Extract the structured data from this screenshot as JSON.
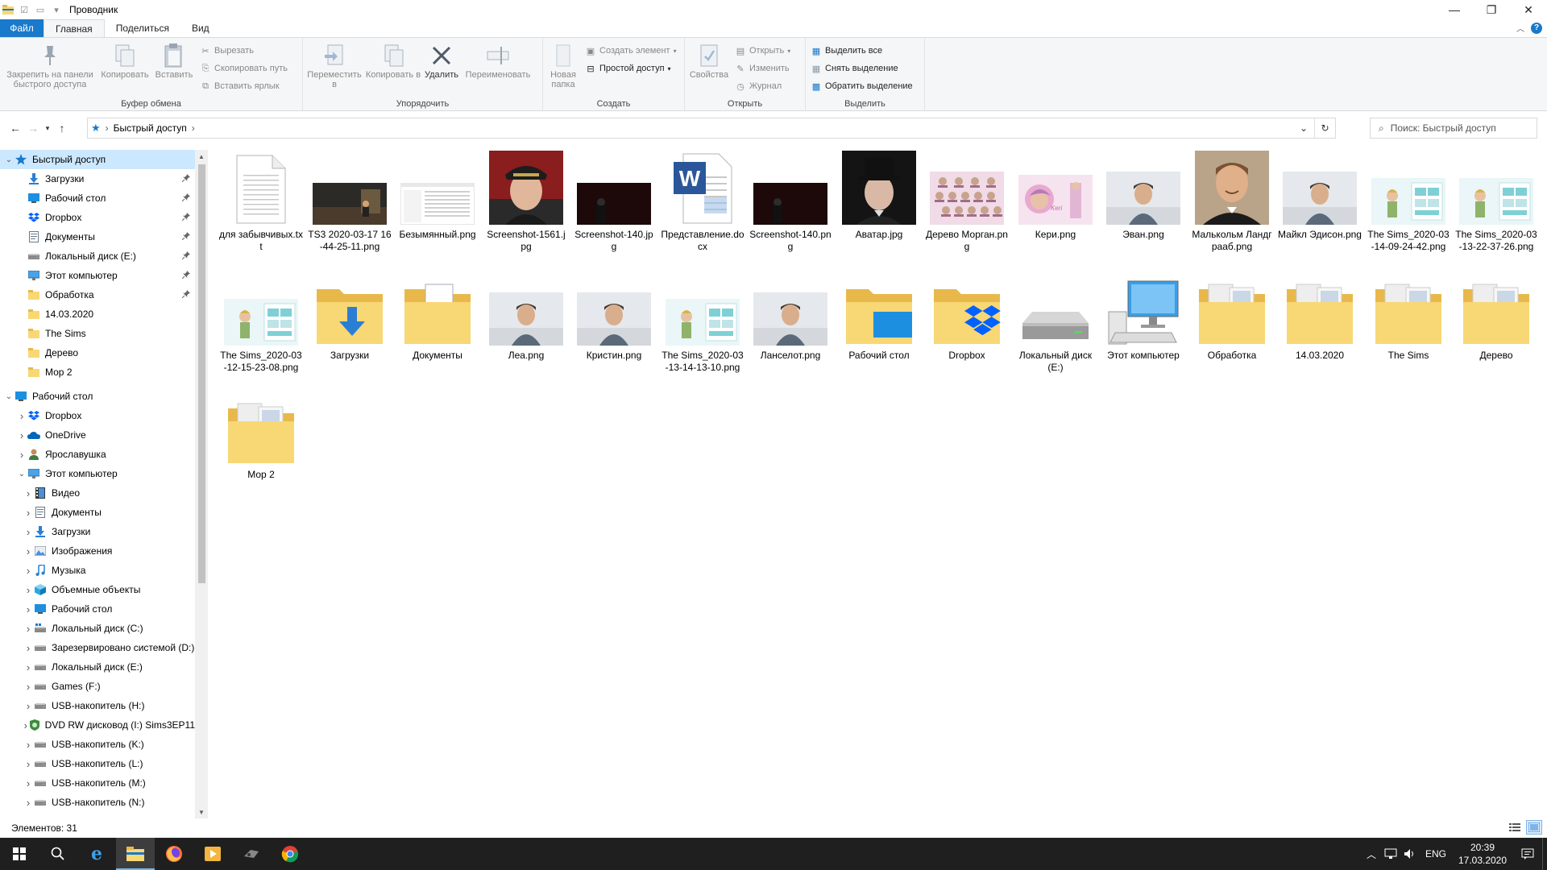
{
  "window": {
    "title": "Проводник",
    "controls": {
      "minimize": "—",
      "maximize": "❐",
      "close": "✕"
    }
  },
  "ribbon_tabs": [
    {
      "label": "Файл"
    },
    {
      "label": "Главная"
    },
    {
      "label": "Поделиться"
    },
    {
      "label": "Вид"
    }
  ],
  "ribbon": {
    "clipboard": {
      "group_label": "Буфер обмена",
      "pin": "Закрепить на панели быстрого доступа",
      "copy": "Копировать",
      "paste": "Вставить",
      "cut": "Вырезать",
      "copy_path": "Скопировать путь",
      "paste_shortcut": "Вставить ярлык"
    },
    "organize": {
      "group_label": "Упорядочить",
      "move_to": "Переместить в",
      "copy_to": "Копировать в",
      "delete": "Удалить",
      "rename": "Переименовать"
    },
    "new": {
      "group_label": "Создать",
      "new_folder": "Новая папка",
      "new_item": "Создать элемент",
      "easy_access": "Простой доступ"
    },
    "open": {
      "group_label": "Открыть",
      "properties": "Свойства",
      "open": "Открыть",
      "edit": "Изменить",
      "history": "Журнал"
    },
    "select": {
      "group_label": "Выделить",
      "select_all": "Выделить все",
      "select_none": "Снять выделение",
      "invert": "Обратить выделение"
    }
  },
  "address": {
    "separator": "›",
    "path": "Быстрый доступ",
    "search_placeholder": "Поиск: Быстрый доступ"
  },
  "sidebar": {
    "items": [
      {
        "label": "Быстрый доступ",
        "icon": "star-icon",
        "level": 0,
        "arrow": "expanded",
        "pinned": false,
        "selected": true
      },
      {
        "label": "Загрузки",
        "icon": "downloads-icon",
        "level": 1,
        "arrow": "none",
        "pinned": true
      },
      {
        "label": "Рабочий стол",
        "icon": "desktop-icon",
        "level": 1,
        "arrow": "none",
        "pinned": true
      },
      {
        "label": "Dropbox",
        "icon": "dropbox-icon",
        "level": 1,
        "arrow": "none",
        "pinned": true
      },
      {
        "label": "Документы",
        "icon": "documents-icon",
        "level": 1,
        "arrow": "none",
        "pinned": true
      },
      {
        "label": "Локальный диск (E:)",
        "icon": "drive-icon",
        "level": 1,
        "arrow": "none",
        "pinned": true
      },
      {
        "label": "Этот компьютер",
        "icon": "computer-icon",
        "level": 1,
        "arrow": "none",
        "pinned": true
      },
      {
        "label": "Обработка",
        "icon": "folder-icon",
        "level": 1,
        "arrow": "none",
        "pinned": true
      },
      {
        "label": "14.03.2020",
        "icon": "folder-icon",
        "level": 1,
        "arrow": "none",
        "pinned": false
      },
      {
        "label": "The Sims",
        "icon": "folder-icon",
        "level": 1,
        "arrow": "none",
        "pinned": false
      },
      {
        "label": "Дерево",
        "icon": "folder-icon",
        "level": 1,
        "arrow": "none",
        "pinned": false
      },
      {
        "label": "Мор 2",
        "icon": "folder-icon",
        "level": 1,
        "arrow": "none",
        "pinned": false
      },
      {
        "label": "Рабочий стол",
        "icon": "desktop-icon",
        "level": 0,
        "arrow": "expanded",
        "pinned": false,
        "gap": true
      },
      {
        "label": "Dropbox",
        "icon": "dropbox-icon",
        "level": 1,
        "arrow": "collapsed",
        "pinned": false
      },
      {
        "label": "OneDrive",
        "icon": "onedrive-icon",
        "level": 1,
        "arrow": "collapsed",
        "pinned": false
      },
      {
        "label": "Ярославушка",
        "icon": "user-icon",
        "level": 1,
        "arrow": "collapsed",
        "pinned": false
      },
      {
        "label": "Этот компьютер",
        "icon": "computer-icon",
        "level": 1,
        "arrow": "expanded",
        "pinned": false
      },
      {
        "label": "Видео",
        "icon": "video-icon",
        "level": 2,
        "arrow": "collapsed",
        "pinned": false
      },
      {
        "label": "Документы",
        "icon": "documents-icon",
        "level": 2,
        "arrow": "collapsed",
        "pinned": false
      },
      {
        "label": "Загрузки",
        "icon": "downloads-icon",
        "level": 2,
        "arrow": "collapsed",
        "pinned": false
      },
      {
        "label": "Изображения",
        "icon": "pictures-icon",
        "level": 2,
        "arrow": "collapsed",
        "pinned": false
      },
      {
        "label": "Музыка",
        "icon": "music-icon",
        "level": 2,
        "arrow": "collapsed",
        "pinned": false
      },
      {
        "label": "Объемные объекты",
        "icon": "3d-objects-icon",
        "level": 2,
        "arrow": "collapsed",
        "pinned": false
      },
      {
        "label": "Рабочий стол",
        "icon": "desktop-icon",
        "level": 2,
        "arrow": "collapsed",
        "pinned": false
      },
      {
        "label": "Локальный диск (C:)",
        "icon": "system-drive-icon",
        "level": 2,
        "arrow": "collapsed",
        "pinned": false
      },
      {
        "label": "Зарезервировано системой (D:)",
        "icon": "drive-icon",
        "level": 2,
        "arrow": "collapsed",
        "pinned": false
      },
      {
        "label": "Локальный диск (E:)",
        "icon": "drive-icon",
        "level": 2,
        "arrow": "collapsed",
        "pinned": false
      },
      {
        "label": "Games (F:)",
        "icon": "drive-icon",
        "level": 2,
        "arrow": "collapsed",
        "pinned": false
      },
      {
        "label": "USB-накопитель (H:)",
        "icon": "usb-drive-icon",
        "level": 2,
        "arrow": "collapsed",
        "pinned": false
      },
      {
        "label": "DVD RW дисковод (I:) Sims3EP11",
        "icon": "dvd-icon",
        "level": 2,
        "arrow": "collapsed",
        "pinned": false
      },
      {
        "label": "USB-накопитель (K:)",
        "icon": "usb-drive-icon",
        "level": 2,
        "arrow": "collapsed",
        "pinned": false
      },
      {
        "label": "USB-накопитель (L:)",
        "icon": "usb-drive-icon",
        "level": 2,
        "arrow": "collapsed",
        "pinned": false
      },
      {
        "label": "USB-накопитель (M:)",
        "icon": "usb-drive-icon",
        "level": 2,
        "arrow": "collapsed",
        "pinned": false
      },
      {
        "label": "USB-накопитель (N:)",
        "icon": "usb-drive-icon",
        "level": 2,
        "arrow": "collapsed",
        "pinned": false
      }
    ]
  },
  "files": [
    {
      "label": "для забывчивых.txt",
      "kind": "txt"
    },
    {
      "label": "TS3 2020-03-17 16-44-25-11.png",
      "kind": "img-dark"
    },
    {
      "label": "Безымянный.png",
      "kind": "img-doc"
    },
    {
      "label": "Screenshot-1561.jpg",
      "kind": "img-portrait-red"
    },
    {
      "label": "Screenshot-140.jpg",
      "kind": "img-black"
    },
    {
      "label": "Представление.docx",
      "kind": "docx"
    },
    {
      "label": "Screenshot-140.png",
      "kind": "img-black"
    },
    {
      "label": "Аватар.jpg",
      "kind": "img-portrait-dark"
    },
    {
      "label": "Дерево Морган.png",
      "kind": "img-tree"
    },
    {
      "label": "Кери.png",
      "kind": "img-pink"
    },
    {
      "label": "Эван.png",
      "kind": "img-sim-light"
    },
    {
      "label": "Малькольм Ландграаб.png",
      "kind": "img-portrait-suit"
    },
    {
      "label": "Майкл Эдисон.png",
      "kind": "img-sim-light"
    },
    {
      "label": "The Sims_2020-03-14-09-24-42.png",
      "kind": "img-cas"
    },
    {
      "label": "The Sims_2020-03-13-22-37-26.png",
      "kind": "img-cas"
    },
    {
      "label": "The Sims_2020-03-12-15-23-08.png",
      "kind": "img-cas"
    },
    {
      "label": "Загрузки",
      "kind": "folder-downloads"
    },
    {
      "label": "Документы",
      "kind": "folder-documents"
    },
    {
      "label": "Леа.png",
      "kind": "img-sim-light"
    },
    {
      "label": "Кристин.png",
      "kind": "img-sim-light"
    },
    {
      "label": "The Sims_2020-03-13-14-13-10.png",
      "kind": "img-cas"
    },
    {
      "label": "Ланселот.png",
      "kind": "img-sim-light"
    },
    {
      "label": "Рабочий стол",
      "kind": "folder-desktop"
    },
    {
      "label": "Dropbox",
      "kind": "folder-dropbox"
    },
    {
      "label": "Локальный диск (E:)",
      "kind": "drive"
    },
    {
      "label": "Этот компьютер",
      "kind": "computer"
    },
    {
      "label": "Обработка",
      "kind": "folder-photos"
    },
    {
      "label": "14.03.2020",
      "kind": "folder-photos"
    },
    {
      "label": "The Sims",
      "kind": "folder-photos"
    },
    {
      "label": "Дерево",
      "kind": "folder-photos"
    },
    {
      "label": "Мор 2",
      "kind": "folder-photos"
    }
  ],
  "status": {
    "count": "Элементов: 31"
  },
  "taskbar": {
    "lang": "ENG",
    "time": "20:39",
    "date": "17.03.2020"
  },
  "colors": {
    "accent": "#1979ca",
    "selection": "#cce8ff",
    "folder": "#f8d775",
    "taskbar": "#1f1f1f"
  }
}
